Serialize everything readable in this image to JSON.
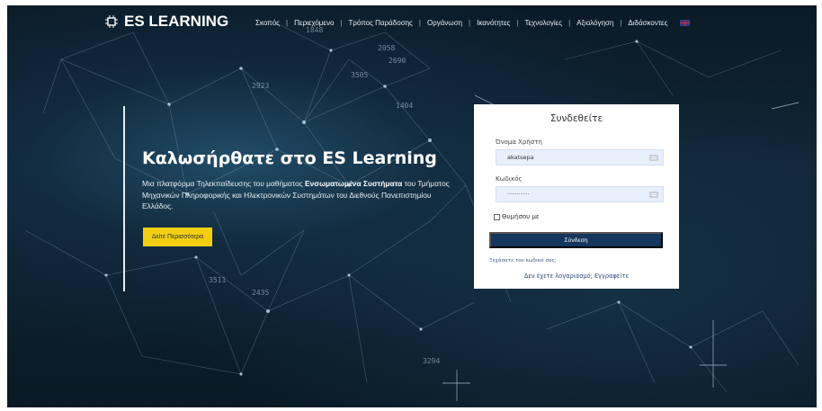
{
  "header": {
    "logo_text": "ES LEARNING",
    "nav": [
      {
        "label": "Σκοπός"
      },
      {
        "label": "Περιεχόμενο"
      },
      {
        "label": "Τρόπος Παράδοσης"
      },
      {
        "label": "Οργάνωση"
      },
      {
        "label": "Ικανότητες"
      },
      {
        "label": "Τεχνολογίες"
      },
      {
        "label": "Αξιολόγηση"
      },
      {
        "label": "Διδάσκοντες"
      }
    ]
  },
  "hero": {
    "title": "Καλωσήρθατε στο ES Learning",
    "desc_pre": "Μια πλατφόρμα Τηλεκπαίδευσης του μαθήματος ",
    "desc_bold": "Ενσωματωμένα Συστήματα",
    "desc_post": " του Τμήματος Μηχανικών Πληροφορικής και Ηλεκτρονικών Συστημάτων του Διεθνούς Πανεπιστημίου Ελλάδος.",
    "cta_label": "Δείτε Περισσότερα"
  },
  "login": {
    "title": "Συνδεθείτε",
    "username_label": "Όνομα Χρήστη",
    "username_value": "akatsepa",
    "password_label": "Κωδικός",
    "password_value": "············",
    "remember_label": "Θυμήσου με",
    "submit_label": "Σύνδεση",
    "forgot_label": "Ξεχάσατε τον κωδικό σας;",
    "signup_label": "Δεν έχετε λογαριασμό; Εγγραφείτε"
  },
  "background_numbers": [
    "1848",
    "2058",
    "2690",
    "3505",
    "2923",
    "1404",
    "3511",
    "2435",
    "3294"
  ],
  "colors": {
    "accent_yellow": "#f2cf12",
    "button_navy": "#15365d",
    "input_bg": "#e8f0fe"
  }
}
